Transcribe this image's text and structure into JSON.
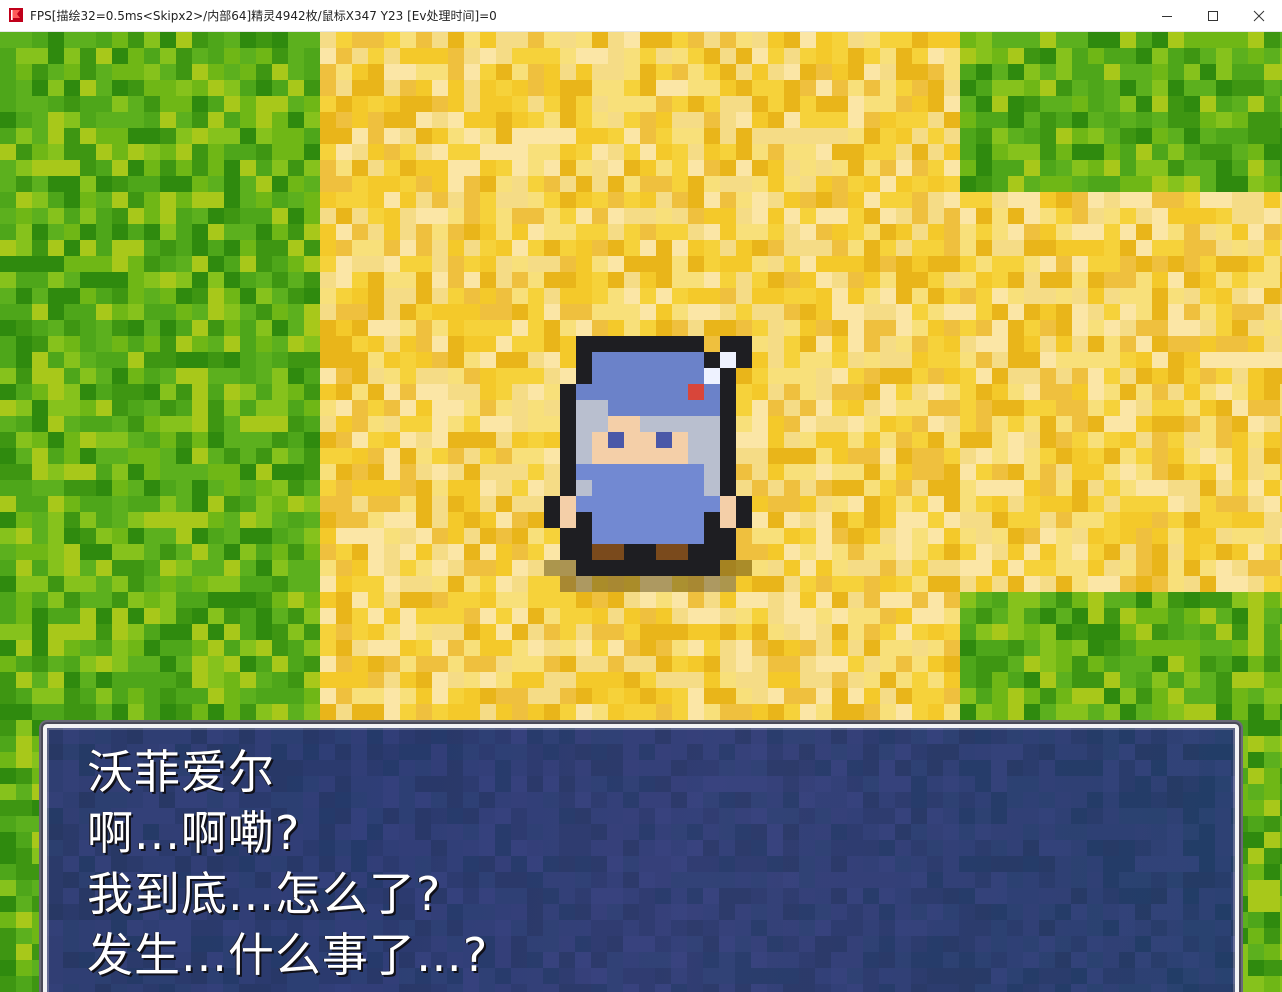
{
  "window": {
    "title": "FPS[描绘32=0.5ms<Skipx2>/内部64]精灵4942枚/鼠标X347 Y23  [Ev处理时间]=0",
    "icon": "app-red-flag-icon",
    "controls": [
      "minimize-icon",
      "maximize-icon",
      "close-icon"
    ]
  },
  "scene": {
    "colors": {
      "grass": "#4ea61a",
      "grass_dark": "#2f8a0e",
      "grass_light": "#86c21c",
      "sand": "#f6d23a",
      "sand_light": "#f5dc86",
      "sand_dark": "#e9b51a"
    },
    "character": {
      "name": "沃菲爱尔",
      "hair_color": "#b9bfcf",
      "hat_color": "#6b82c9",
      "robe_color": "#7289d2"
    }
  },
  "dialog": {
    "speaker": "沃菲爱尔",
    "lines": [
      "啊...啊嘞?",
      "我到底...怎么了?",
      "发生...什么事了…?"
    ]
  }
}
